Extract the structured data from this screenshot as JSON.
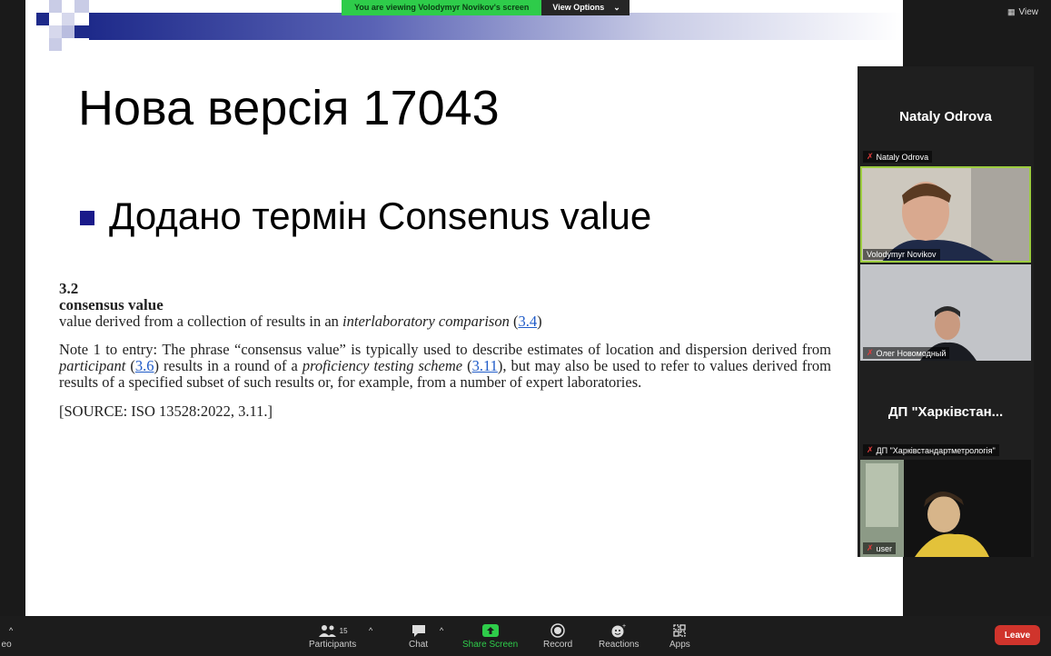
{
  "banner": {
    "status_text": "You are viewing Volodymyr Novikov's screen",
    "view_options_label": "View Options"
  },
  "view_label": "View",
  "slide": {
    "title": "Нова версія 17043",
    "bullet": "Додано термін Consenus value",
    "definition": {
      "number": "3.2",
      "term": "consensus value",
      "def_pre": "value derived from a collection of results in an ",
      "def_italic": "interlaboratory comparison",
      "def_link": "3.4",
      "note_a": "Note 1 to entry: The phrase “consensus value” is typically used to describe estimates of location and dispersion derived from ",
      "note_italic1": "participant",
      "note_link1": "3.6",
      "note_b": " results in a round of a ",
      "note_italic2": "proficiency testing scheme",
      "note_link2": "3.11",
      "note_c": ", but may also be used to refer to values derived from results of a specified subset of such results or, for example, from a number of expert laboratories.",
      "source": "[SOURCE: ISO 13528:2022, 3.11.]"
    }
  },
  "gallery": {
    "tile1_name": "Nataly Odrova",
    "tile1_label": "Nataly Odrova",
    "tile2_label": "Volodymyr Novikov",
    "tile3_label": "Олег Новомодный",
    "tile4_name": "ДП \"Харківстан...",
    "tile4_label": "ДП \"Харківстандартметрологія\"",
    "tile5_label": "user"
  },
  "toolbar": {
    "left_label": "eo",
    "participants_label": "Participants",
    "participants_count": "15",
    "chat_label": "Chat",
    "share_label": "Share Screen",
    "record_label": "Record",
    "reactions_label": "Reactions",
    "apps_label": "Apps",
    "leave_label": "Leave"
  },
  "colors": {
    "share_green": "#2ecc4a",
    "leave_red": "#d0342c",
    "slide_accent": "#1a1a8a",
    "link_blue": "#1f5bc8"
  }
}
